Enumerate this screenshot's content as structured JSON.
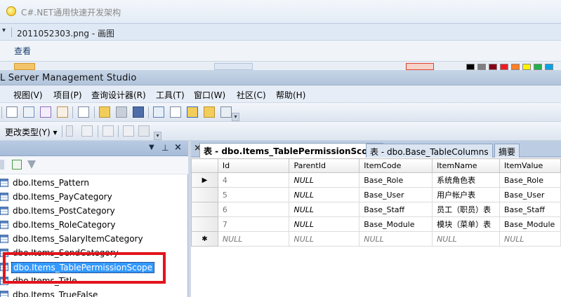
{
  "outer_window": {
    "title": "C#.NET通用快速开发架构"
  },
  "paint_window": {
    "title": "2011052303.png - 画图",
    "ribbon_tab": "查看"
  },
  "ssms": {
    "title": "L Server Management Studio",
    "menu": [
      "视图(V)",
      "项目(P)",
      "查询设计器(R)",
      "工具(T)",
      "窗口(W)",
      "社区(C)",
      "帮助(H)"
    ],
    "toolbar2_combo": "更改类型(Y) ▾"
  },
  "object_explorer": {
    "items": [
      "dbo.Items_Pattern",
      "dbo.Items_PayCategory",
      "dbo.Items_PostCategory",
      "dbo.Items_RoleCategory",
      "dbo.Items_SalaryItemCategory",
      "dbo.Items_SendCategory",
      "dbo.Items_TablePermissionScope",
      "dbo.Items_Title",
      "dbo.Items_TrueFalse"
    ],
    "selected_index": 6
  },
  "tabs": [
    "表 - dbo.Items_TablePermissionScope",
    "表 - dbo.Base_TableColumns",
    "摘要"
  ],
  "grid": {
    "columns": [
      "Id",
      "ParentId",
      "ItemCode",
      "ItemName",
      "ItemValue"
    ],
    "rows": [
      {
        "marker": "▶",
        "cells": [
          "4",
          "NULL",
          "Base_Role",
          "系统角色表",
          "Base_Role"
        ]
      },
      {
        "marker": "",
        "cells": [
          "5",
          "NULL",
          "Base_User",
          "用户帐户表",
          "Base_User"
        ]
      },
      {
        "marker": "",
        "cells": [
          "6",
          "NULL",
          "Base_Staff",
          "员工（职员）表",
          "Base_Staff"
        ]
      },
      {
        "marker": "",
        "cells": [
          "7",
          "NULL",
          "Base_Module",
          "模块（菜单）表",
          "Base_Module"
        ]
      },
      {
        "marker": "✱",
        "cells": [
          "NULL",
          "NULL",
          "NULL",
          "NULL",
          "NULL"
        ]
      }
    ]
  },
  "colors": {
    "selection": "#3399ff",
    "annotation_box": "#e2141c"
  }
}
